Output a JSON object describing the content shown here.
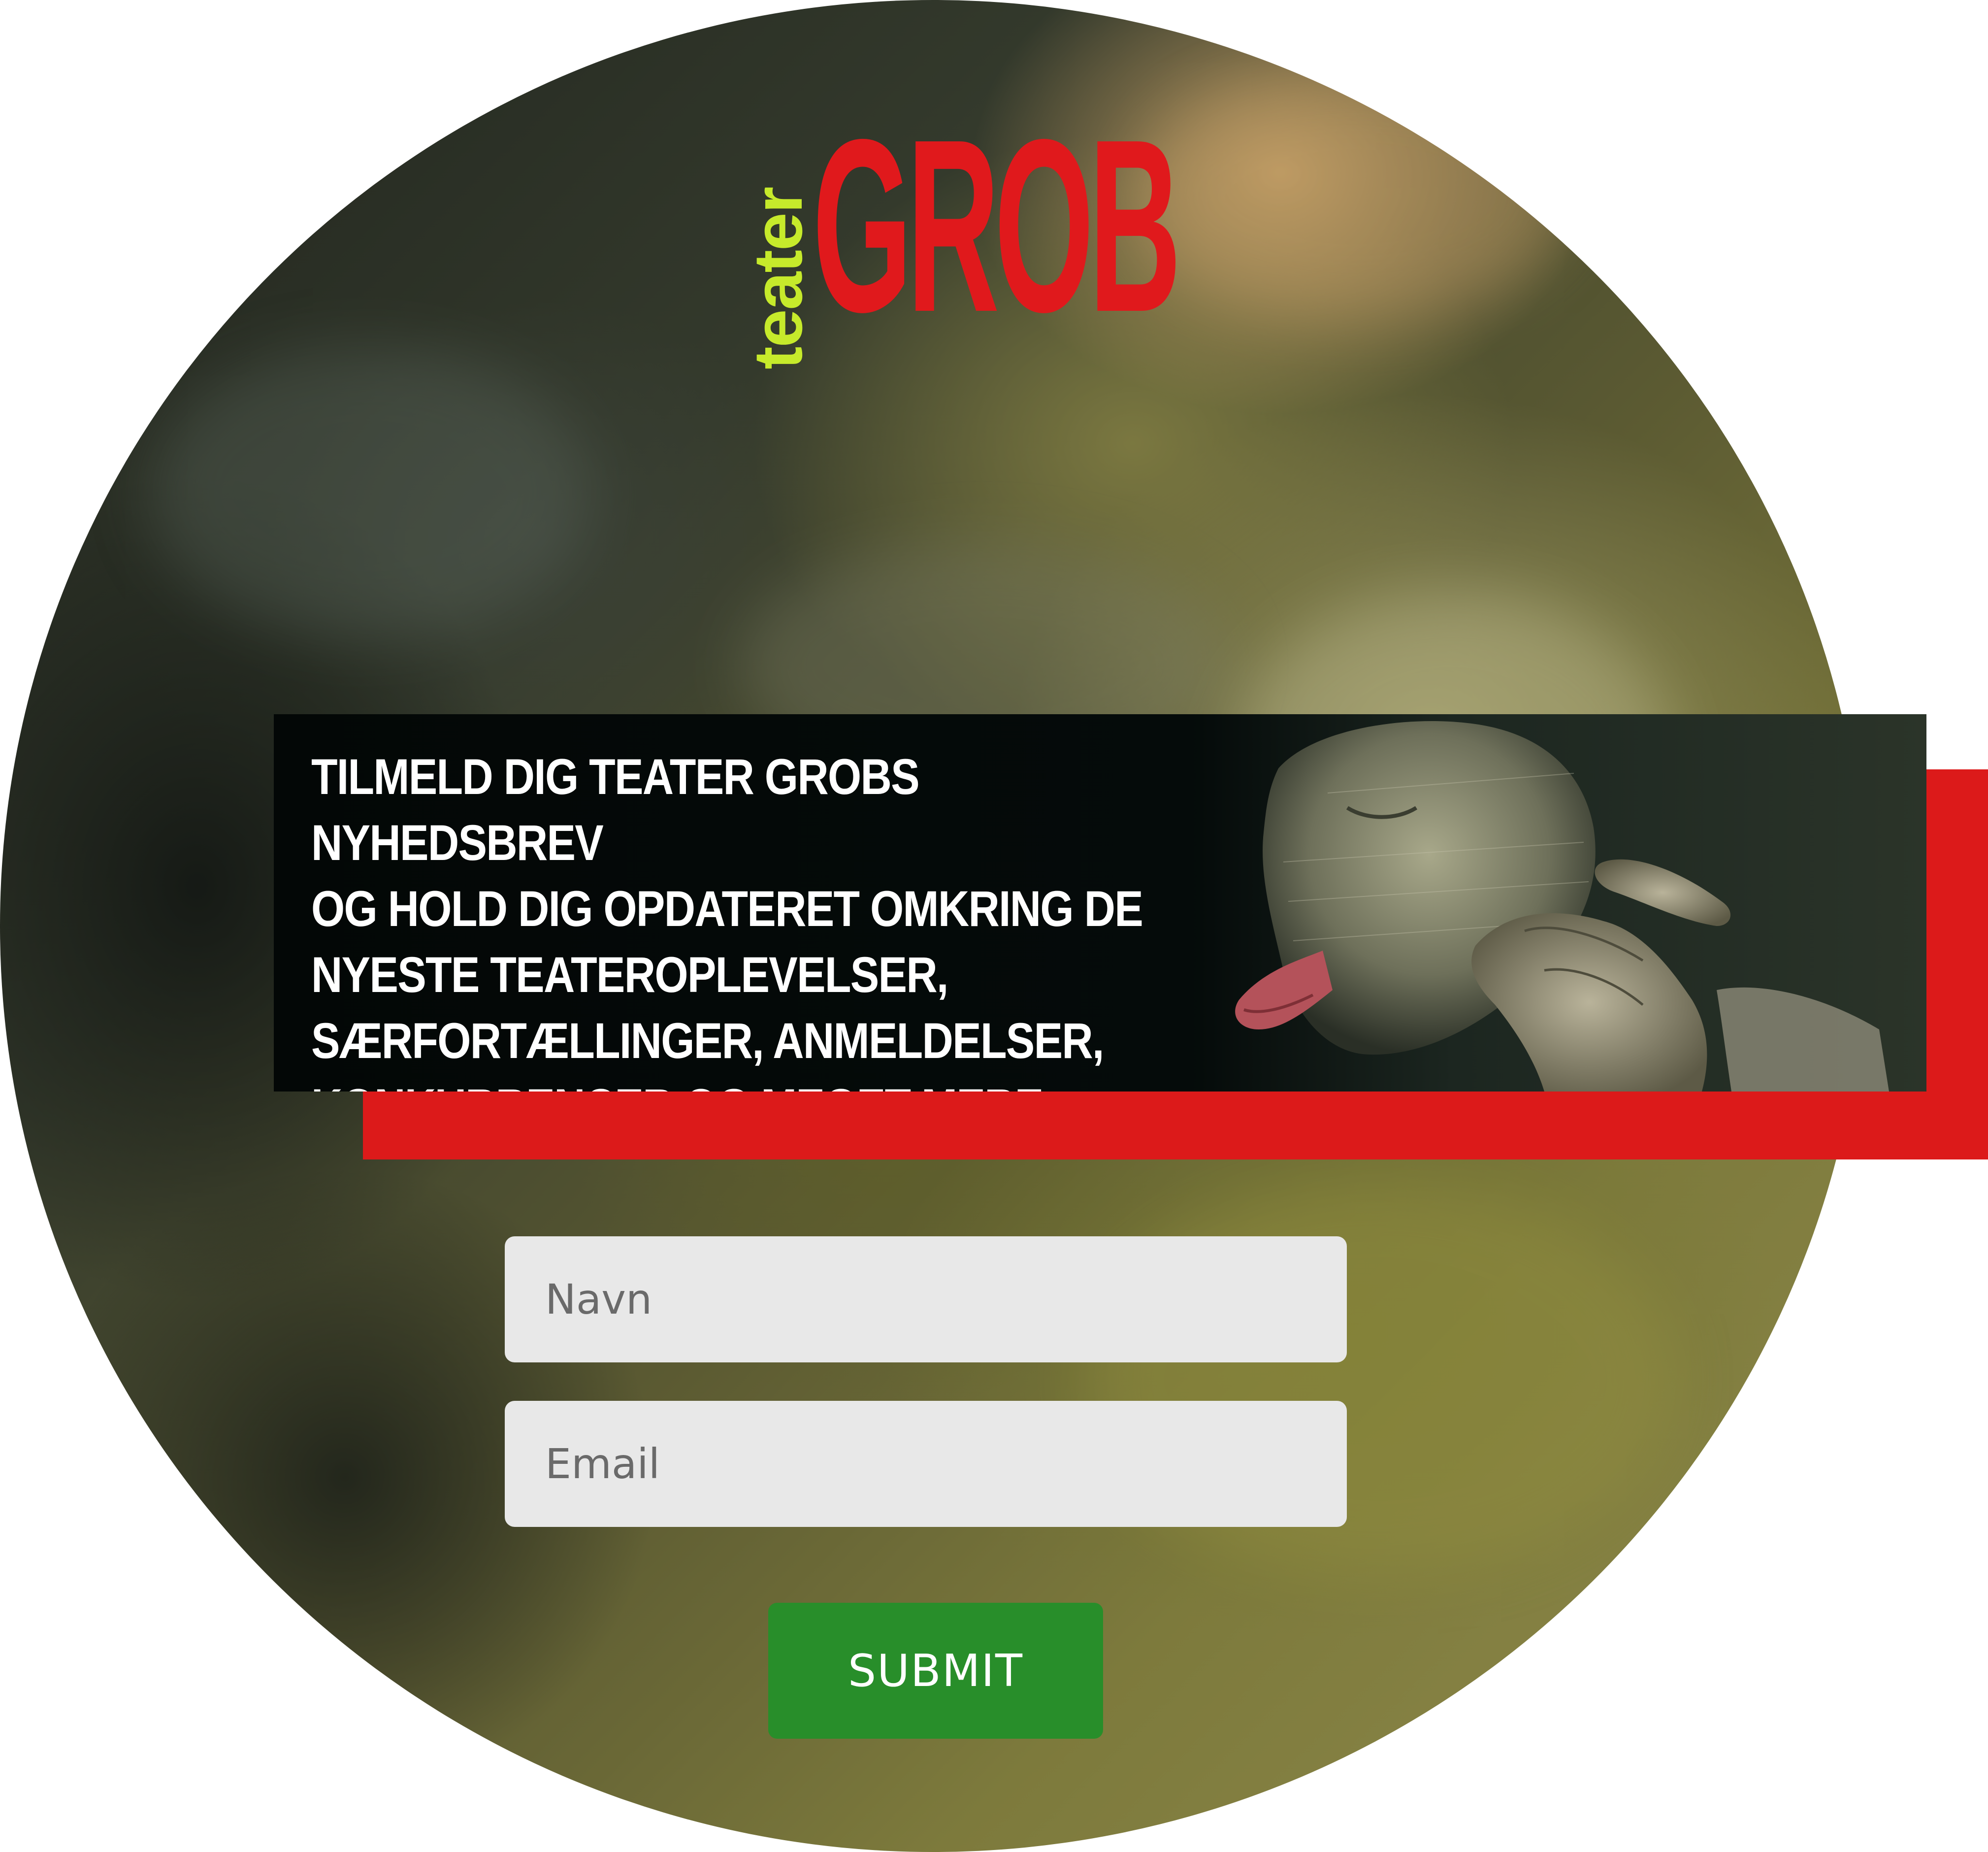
{
  "logo": {
    "small_word": "teater",
    "big_word": "GROB"
  },
  "banner": {
    "headline_lines": [
      "TILMELD DIG TEATER GROBS NYHEDSBREV",
      "OG HOLD DIG OPDATERET OMKRING DE",
      "NYESTE TEATEROPLEVELSER,",
      "SÆRFORTÆLLINGER, ANMELDELSER,",
      "KONKURRENCER OG MEGET MERE."
    ]
  },
  "form": {
    "name_placeholder": "Navn",
    "email_placeholder": "Email",
    "submit_label": "SUBMIT"
  },
  "colors": {
    "brand_red": "#dc1a1a",
    "logo_green": "#c6ea2b",
    "submit_green": "#288e2a",
    "field_bg": "#e8e8e8"
  }
}
